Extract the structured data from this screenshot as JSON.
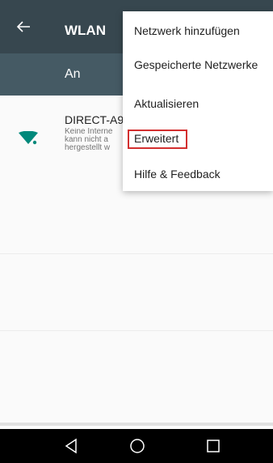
{
  "appbar": {
    "title": "WLAN",
    "back_icon": "arrow-left-icon"
  },
  "switchbar": {
    "label": "An"
  },
  "network": {
    "name": "DIRECT-A9",
    "status_lines": [
      "Keine Interne",
      "kann nicht a",
      "hergestellt w"
    ],
    "icon": "wifi-signal-icon"
  },
  "menu": {
    "items": [
      {
        "label": "Netzwerk hinzufügen"
      },
      {
        "label": "Gespeicherte Netzwerke"
      },
      {
        "label": "Aktualisieren"
      },
      {
        "label": "Erweitert",
        "highlighted": true
      },
      {
        "label": "Hilfe & Feedback"
      }
    ]
  },
  "navbar": {
    "back": "nav-back-icon",
    "home": "nav-home-icon",
    "recents": "nav-recents-icon"
  },
  "colors": {
    "appbar": "#37474f",
    "switchbar": "#455a64",
    "accent": "#00897b",
    "highlight": "#d32f2f"
  }
}
